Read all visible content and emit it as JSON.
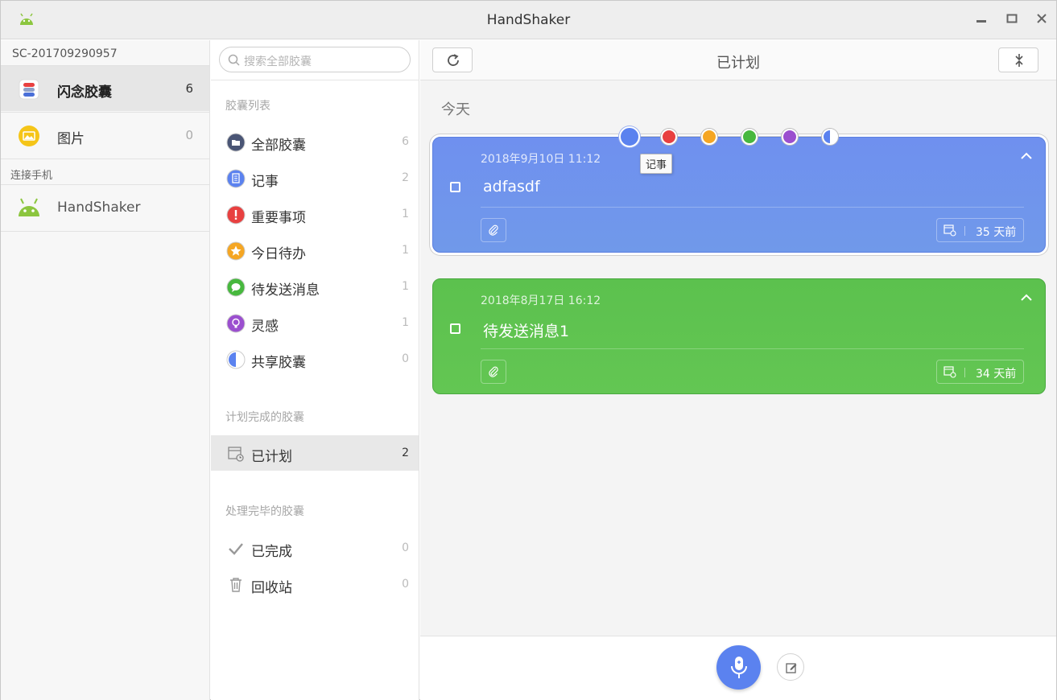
{
  "window": {
    "title": "HandShaker",
    "min_icon": "minimize-icon",
    "max_icon": "maximize-icon",
    "close_icon": "close-icon"
  },
  "sidebar": {
    "device_id": "SC-201709290957",
    "items": [
      {
        "label": "闪念胶囊",
        "count": "6",
        "icon": "capsule-icon",
        "active": true
      },
      {
        "label": "图片",
        "count": "0",
        "icon": "image-icon",
        "active": false
      }
    ],
    "connect_label": "连接手机",
    "phone": {
      "label": "HandShaker",
      "icon": "android-icon"
    }
  },
  "capsule_panel": {
    "search_placeholder": "搜索全部胶囊",
    "section_list": "胶囊列表",
    "list": [
      {
        "label": "全部胶囊",
        "count": "6",
        "icon": "all-capsules-icon",
        "color": "#4a5575"
      },
      {
        "label": "记事",
        "count": "2",
        "icon": "note-icon",
        "color": "#5b82ef"
      },
      {
        "label": "重要事项",
        "count": "1",
        "icon": "important-icon",
        "color": "#e84040"
      },
      {
        "label": "今日待办",
        "count": "1",
        "icon": "star-icon",
        "color": "#f5a623"
      },
      {
        "label": "待发送消息",
        "count": "1",
        "icon": "message-icon",
        "color": "#47b83e"
      },
      {
        "label": "灵感",
        "count": "1",
        "icon": "bulb-icon",
        "color": "#9b4fcf"
      },
      {
        "label": "共享胶囊",
        "count": "0",
        "icon": "share-icon",
        "color": "#5b82ef"
      }
    ],
    "section_planned": "计划完成的胶囊",
    "planned": {
      "label": "已计划",
      "count": "2",
      "icon": "calendar-icon"
    },
    "section_done": "处理完毕的胶囊",
    "done": [
      {
        "label": "已完成",
        "count": "0",
        "icon": "check-icon"
      },
      {
        "label": "回收站",
        "count": "0",
        "icon": "trash-icon"
      }
    ]
  },
  "main": {
    "title": "已计划",
    "refresh_icon": "refresh-icon",
    "collapse_icon": "collapse-icon",
    "group_label": "今天",
    "palette": {
      "colors": [
        "#5b82ef",
        "#e84040",
        "#f5a623",
        "#47b83e",
        "#9b4fcf",
        "#5b82ef"
      ],
      "selected": 0,
      "tooltip": "记事"
    },
    "cards": [
      {
        "date": "2018年9月10日 11:12",
        "text": "adfasdf",
        "due": "35 天前",
        "color": "#6f90ef"
      },
      {
        "date": "2018年8月17日 16:12",
        "text": "待发送消息1",
        "due": "34 天前",
        "color": "#5cc14e"
      }
    ],
    "mic_icon": "microphone-icon",
    "edit_icon": "edit-icon"
  }
}
